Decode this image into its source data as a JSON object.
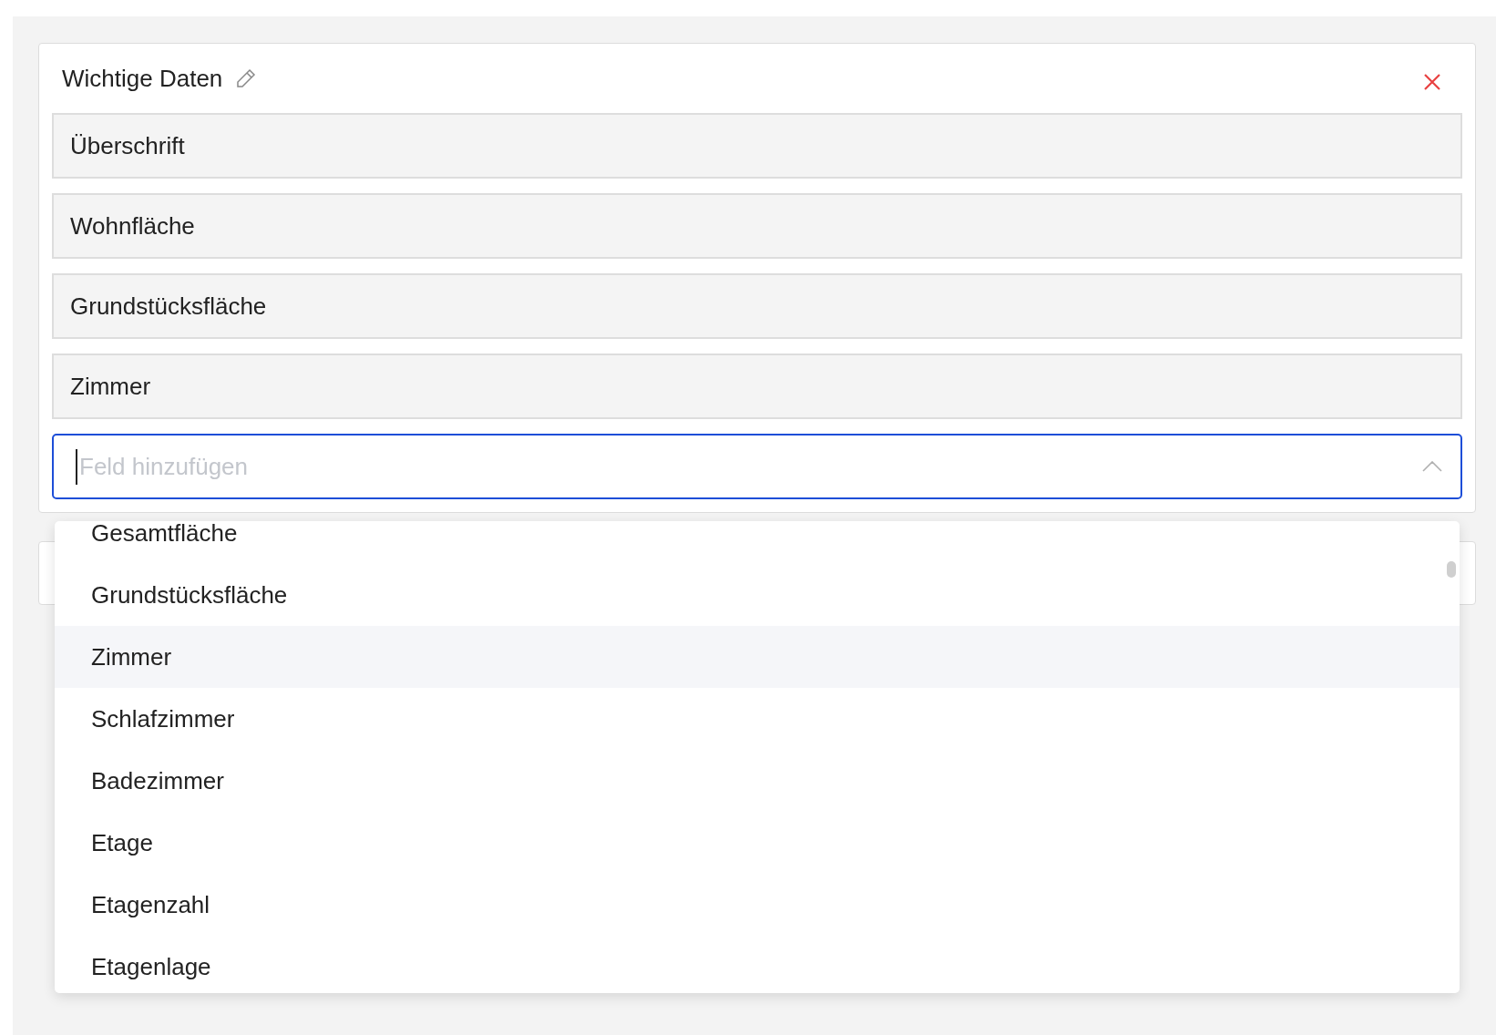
{
  "card": {
    "title": "Wichtige Daten",
    "fields": [
      "Überschrift",
      "Wohnfläche",
      "Grundstücksfläche",
      "Zimmer"
    ],
    "select": {
      "placeholder": "Feld hinzufügen",
      "expanded": true
    }
  },
  "dropdown": {
    "options": [
      {
        "label": "Gesamtfläche",
        "selected": false
      },
      {
        "label": "Grundstücksfläche",
        "selected": false
      },
      {
        "label": "Zimmer",
        "selected": true
      },
      {
        "label": "Schlafzimmer",
        "selected": false
      },
      {
        "label": "Badezimmer",
        "selected": false
      },
      {
        "label": "Etage",
        "selected": false
      },
      {
        "label": "Etagenzahl",
        "selected": false
      },
      {
        "label": "Etagenlage",
        "selected": false
      }
    ]
  }
}
